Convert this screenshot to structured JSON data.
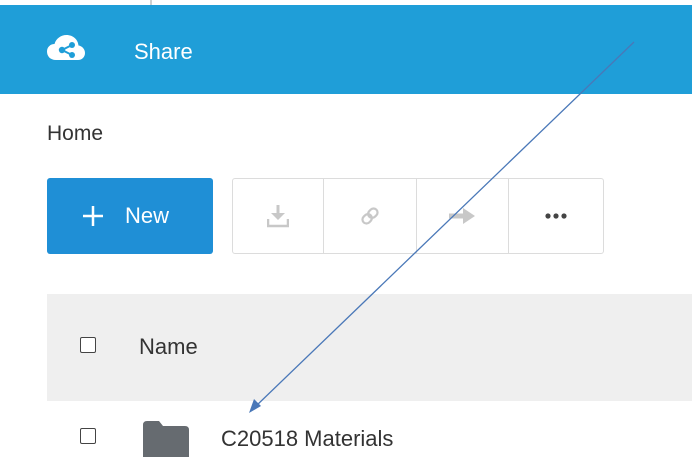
{
  "header": {
    "title": "Share",
    "logo_icon": "cloud-share-icon",
    "background_color": "#1f9ed8"
  },
  "breadcrumb": {
    "label": "Home"
  },
  "toolbar": {
    "new_label": "New",
    "new_button_color": "#1f8fd6",
    "buttons": [
      {
        "icon": "download-icon"
      },
      {
        "icon": "link-icon"
      },
      {
        "icon": "arrow-right-icon"
      },
      {
        "icon": "more-icon",
        "label": "•••"
      }
    ]
  },
  "list": {
    "header": {
      "name_label": "Name"
    },
    "items": [
      {
        "icon": "folder-icon",
        "name": "C20518 Materials"
      }
    ]
  },
  "annotation": {
    "type": "arrow",
    "color": "#4a78b8"
  }
}
